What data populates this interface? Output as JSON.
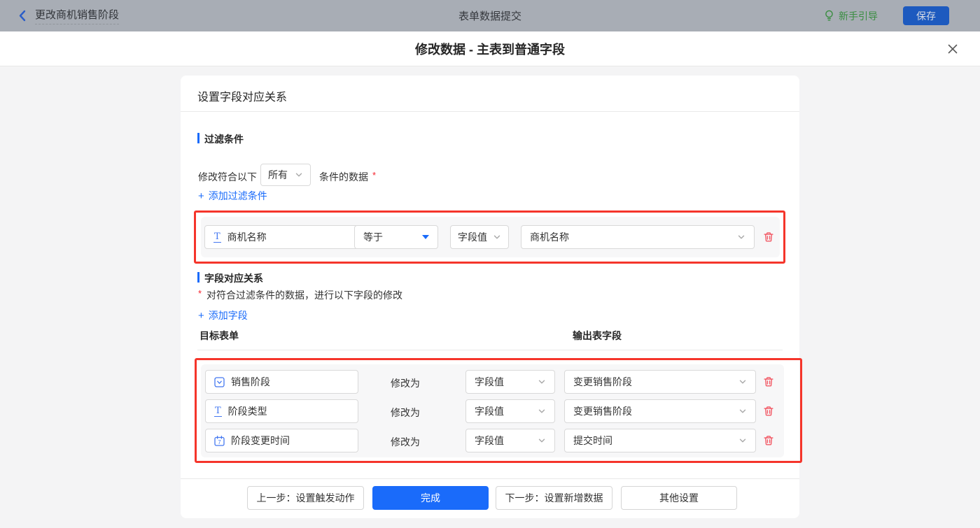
{
  "topbar": {
    "back_label": "更改商机销售阶段",
    "center_title": "表单数据提交",
    "guide_label": "新手引导",
    "save_label": "保存"
  },
  "modal": {
    "title": "修改数据 - 主表到普通字段"
  },
  "panel": {
    "title": "设置字段对应关系",
    "filter": {
      "heading": "过滤条件",
      "match_prefix": "修改符合以下",
      "match_value": "所有",
      "match_suffix": "条件的数据",
      "required_mark": "*",
      "add_label": "添加过滤条件",
      "row": {
        "field": "商机名称",
        "operator": "等于",
        "value_type": "字段值",
        "value": "商机名称"
      }
    },
    "mapping": {
      "heading": "字段对应关系",
      "required_mark": "*",
      "description": "对符合过滤条件的数据，进行以下字段的修改",
      "add_label": "添加字段",
      "columns": {
        "target": "目标表单",
        "output": "输出表字段"
      },
      "rows": [
        {
          "field": "销售阶段",
          "modify_label": "修改为",
          "value_type": "字段值",
          "value": "变更销售阶段"
        },
        {
          "field": "阶段类型",
          "modify_label": "修改为",
          "value_type": "字段值",
          "value": "变更销售阶段"
        },
        {
          "field": "阶段变更时间",
          "modify_label": "修改为",
          "value_type": "字段值",
          "value": "提交时间"
        }
      ]
    },
    "footer": {
      "prev_label": "上一步：设置触发动作",
      "done_label": "完成",
      "next_label": "下一步：设置新增数据",
      "other_label": "其他设置"
    }
  },
  "icons": {
    "plus": "+",
    "text_field_glyph": "T",
    "calendar_day": "7"
  },
  "colors": {
    "accent_blue": "#1a6bfa",
    "annotation_red": "#f5352b",
    "trash_red": "#f25864",
    "guide_green": "#3a8d41",
    "save_button_blue": "#1d5abf",
    "required_red": "#f5222d",
    "topbar_dimmed_gray": "#a8adb5"
  }
}
